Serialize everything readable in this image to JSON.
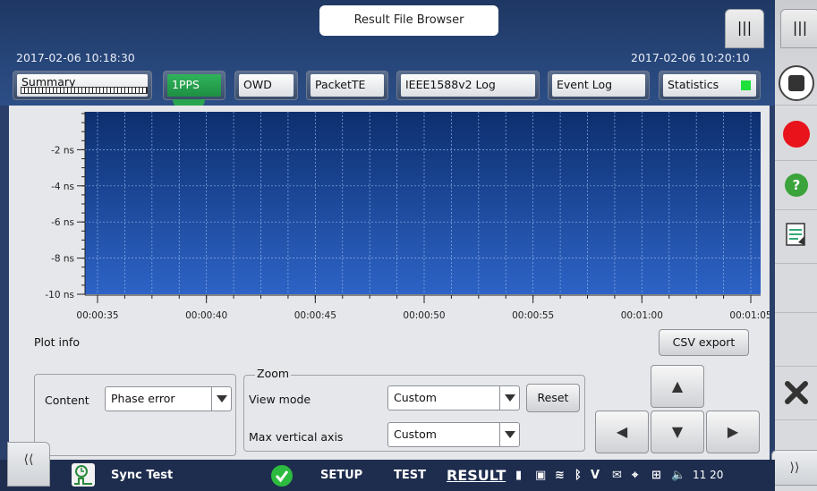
{
  "header": {
    "title": "Result File Browser",
    "start_time": "2017-02-06 10:18:30",
    "end_time": "2017-02-06 10:20:10",
    "tabs": [
      {
        "label": "Summary"
      },
      {
        "label": "1PPS"
      },
      {
        "label": "OWD"
      },
      {
        "label": "PacketTE"
      },
      {
        "label": "IEEE1588v2 Log"
      },
      {
        "label": "Event Log"
      },
      {
        "label": "Statistics"
      }
    ],
    "active_tab": "1PPS"
  },
  "chart_data": {
    "type": "area",
    "y_tick_labels": [
      "-2 ns",
      "-4 ns",
      "-6 ns",
      "-8 ns",
      "-10 ns"
    ],
    "y_ticks": [
      -2,
      -4,
      -6,
      -8,
      -10
    ],
    "ylim": [
      -10,
      0
    ],
    "x_tick_labels": [
      "00:00:35",
      "00:00:40",
      "00:00:45",
      "00:00:50",
      "00:00:55",
      "00:01:00",
      "00:01:05"
    ],
    "grid": true,
    "colors": {
      "fill_top": "#0d2f6e",
      "fill_bottom": "#2d63c6",
      "grid": "#8fb0e8"
    }
  },
  "plot_info": {
    "label": "Plot info",
    "csv_export": "CSV export"
  },
  "content": {
    "label": "Content",
    "value": "Phase error"
  },
  "zoom": {
    "legend": "Zoom",
    "view_mode_label": "View mode",
    "view_mode_value": "Custom",
    "reset": "Reset",
    "max_vertical_label": "Max vertical axis",
    "max_vertical_value": "Custom"
  },
  "status_bar": {
    "app_name": "Sync Test",
    "setup": "SETUP",
    "test": "TEST",
    "result": "RESULT",
    "clock": "11 20"
  }
}
